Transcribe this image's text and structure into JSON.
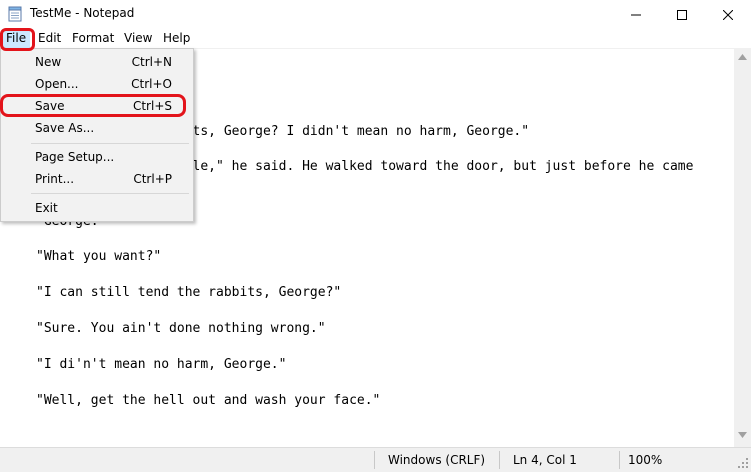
{
  "window": {
    "title": "TestMe - Notepad",
    "app_icon": "notepad-icon",
    "controls": [
      "minimize-icon",
      "maximize-icon",
      "close-icon"
    ]
  },
  "menubar": {
    "items": [
      "File",
      "Edit",
      "Format",
      "View",
      "Help"
    ]
  },
  "file_menu": {
    "items": [
      {
        "label": "New",
        "shortcut": "Ctrl+N"
      },
      {
        "label": "Open...",
        "shortcut": "Ctrl+O"
      },
      {
        "label": "Save",
        "shortcut": "Ctrl+S"
      },
      {
        "label": "Save As...",
        "shortcut": ""
      },
      {
        "label": "Page Setup...",
        "shortcut": ""
      },
      {
        "label": "Print...",
        "shortcut": "Ctrl+P"
      },
      {
        "label": "Exit",
        "shortcut": ""
      }
    ]
  },
  "document": {
    "lines": [
      "",
      "",
      "                 bbits, George? I didn't mean no harm, George.\"",
      "                 ouble,\" he said. He walked toward the door, but just before he came",
      "\"George.\"",
      "\"What you want?\"",
      "\"I can still tend the rabbits, George?\"",
      "\"Sure. You ain't done nothing wrong.\"",
      "\"I di'n't mean no harm, George.\"",
      "\"Well, get the hell out and wash your face.\""
    ]
  },
  "statusbar": {
    "line_ending": "Windows (CRLF)",
    "position": "Ln 4, Col 1",
    "zoom": "100%"
  },
  "colors": {
    "highlight": "#e3141b",
    "menu_selected": "#cce8ff"
  }
}
